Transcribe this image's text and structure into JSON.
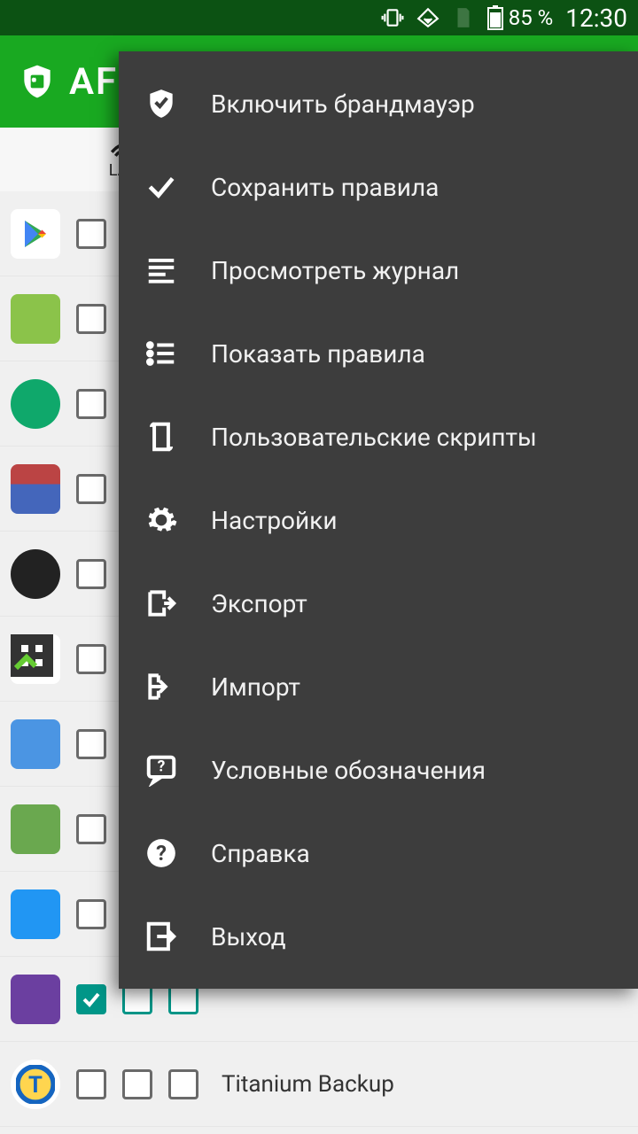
{
  "status_bar": {
    "battery": "85 %",
    "time": "12:30"
  },
  "app_bar": {
    "title": "AFW"
  },
  "col_header": {
    "lan_label": "LAN"
  },
  "apps": {
    "titanium": "Titanium Backup"
  },
  "menu": {
    "enable_firewall": "Включить брандмауэр",
    "save_rules": "Сохранить правила",
    "view_log": "Просмотреть журнал",
    "show_rules": "Показать правила",
    "custom_scripts": "Пользовательские скрипты",
    "settings": "Настройки",
    "export": "Экспорт",
    "import": "Импорт",
    "legend": "Условные обозначения",
    "help": "Справка",
    "exit": "Выход"
  }
}
